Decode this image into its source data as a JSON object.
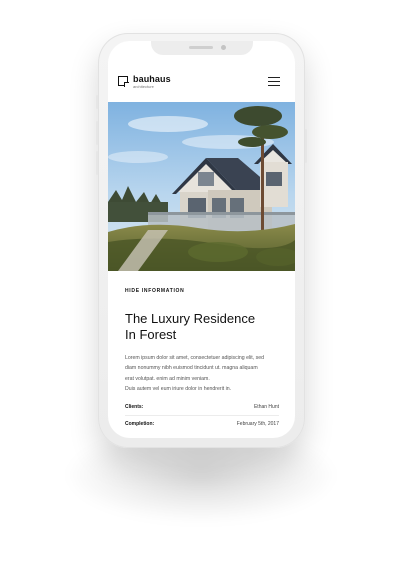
{
  "brand": {
    "name": "bauhaus",
    "subtitle": "architecture"
  },
  "header": {
    "menu_icon": "hamburger-icon"
  },
  "project": {
    "hide_info_label": "HIDE INFORMATION",
    "title_line1": "The Luxury Residence",
    "title_line2": "In Forest",
    "body_lines": [
      "Lorem ipsum dolor sit amet, consectetuer adipiscing elit, sed",
      "diam nonummy nibh euismod tincidunt ut. magna aliquam",
      "erat volutpat. enim ad minim veniam.",
      "Duis autem vel eum iriure dolor in hendrerit in."
    ],
    "details": [
      {
        "label": "Clients:",
        "value": "Ethan Hunt"
      },
      {
        "label": "Completion:",
        "value": "February 5th, 2017"
      }
    ]
  },
  "colors": {
    "text": "#111111",
    "muted": "#555555",
    "phone_frame": "#efefef",
    "sky": "#9cc3e6",
    "roof": "#3c4452"
  }
}
